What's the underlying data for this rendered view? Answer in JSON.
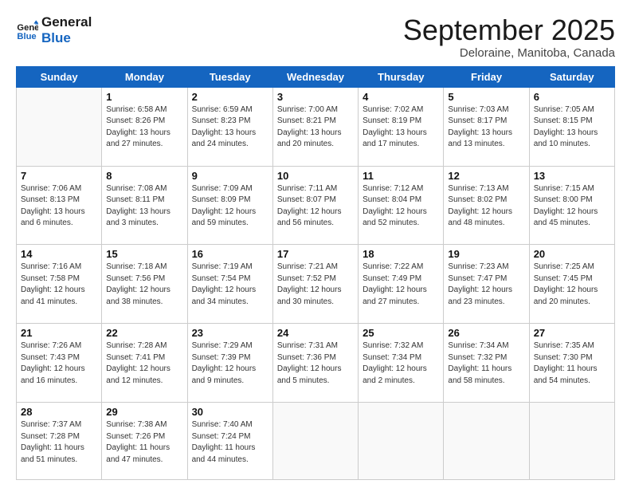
{
  "logo": {
    "line1": "General",
    "line2": "Blue"
  },
  "title": "September 2025",
  "subtitle": "Deloraine, Manitoba, Canada",
  "weekdays": [
    "Sunday",
    "Monday",
    "Tuesday",
    "Wednesday",
    "Thursday",
    "Friday",
    "Saturday"
  ],
  "weeks": [
    [
      {
        "day": "",
        "info": ""
      },
      {
        "day": "1",
        "info": "Sunrise: 6:58 AM\nSunset: 8:26 PM\nDaylight: 13 hours\nand 27 minutes."
      },
      {
        "day": "2",
        "info": "Sunrise: 6:59 AM\nSunset: 8:23 PM\nDaylight: 13 hours\nand 24 minutes."
      },
      {
        "day": "3",
        "info": "Sunrise: 7:00 AM\nSunset: 8:21 PM\nDaylight: 13 hours\nand 20 minutes."
      },
      {
        "day": "4",
        "info": "Sunrise: 7:02 AM\nSunset: 8:19 PM\nDaylight: 13 hours\nand 17 minutes."
      },
      {
        "day": "5",
        "info": "Sunrise: 7:03 AM\nSunset: 8:17 PM\nDaylight: 13 hours\nand 13 minutes."
      },
      {
        "day": "6",
        "info": "Sunrise: 7:05 AM\nSunset: 8:15 PM\nDaylight: 13 hours\nand 10 minutes."
      }
    ],
    [
      {
        "day": "7",
        "info": "Sunrise: 7:06 AM\nSunset: 8:13 PM\nDaylight: 13 hours\nand 6 minutes."
      },
      {
        "day": "8",
        "info": "Sunrise: 7:08 AM\nSunset: 8:11 PM\nDaylight: 13 hours\nand 3 minutes."
      },
      {
        "day": "9",
        "info": "Sunrise: 7:09 AM\nSunset: 8:09 PM\nDaylight: 12 hours\nand 59 minutes."
      },
      {
        "day": "10",
        "info": "Sunrise: 7:11 AM\nSunset: 8:07 PM\nDaylight: 12 hours\nand 56 minutes."
      },
      {
        "day": "11",
        "info": "Sunrise: 7:12 AM\nSunset: 8:04 PM\nDaylight: 12 hours\nand 52 minutes."
      },
      {
        "day": "12",
        "info": "Sunrise: 7:13 AM\nSunset: 8:02 PM\nDaylight: 12 hours\nand 48 minutes."
      },
      {
        "day": "13",
        "info": "Sunrise: 7:15 AM\nSunset: 8:00 PM\nDaylight: 12 hours\nand 45 minutes."
      }
    ],
    [
      {
        "day": "14",
        "info": "Sunrise: 7:16 AM\nSunset: 7:58 PM\nDaylight: 12 hours\nand 41 minutes."
      },
      {
        "day": "15",
        "info": "Sunrise: 7:18 AM\nSunset: 7:56 PM\nDaylight: 12 hours\nand 38 minutes."
      },
      {
        "day": "16",
        "info": "Sunrise: 7:19 AM\nSunset: 7:54 PM\nDaylight: 12 hours\nand 34 minutes."
      },
      {
        "day": "17",
        "info": "Sunrise: 7:21 AM\nSunset: 7:52 PM\nDaylight: 12 hours\nand 30 minutes."
      },
      {
        "day": "18",
        "info": "Sunrise: 7:22 AM\nSunset: 7:49 PM\nDaylight: 12 hours\nand 27 minutes."
      },
      {
        "day": "19",
        "info": "Sunrise: 7:23 AM\nSunset: 7:47 PM\nDaylight: 12 hours\nand 23 minutes."
      },
      {
        "day": "20",
        "info": "Sunrise: 7:25 AM\nSunset: 7:45 PM\nDaylight: 12 hours\nand 20 minutes."
      }
    ],
    [
      {
        "day": "21",
        "info": "Sunrise: 7:26 AM\nSunset: 7:43 PM\nDaylight: 12 hours\nand 16 minutes."
      },
      {
        "day": "22",
        "info": "Sunrise: 7:28 AM\nSunset: 7:41 PM\nDaylight: 12 hours\nand 12 minutes."
      },
      {
        "day": "23",
        "info": "Sunrise: 7:29 AM\nSunset: 7:39 PM\nDaylight: 12 hours\nand 9 minutes."
      },
      {
        "day": "24",
        "info": "Sunrise: 7:31 AM\nSunset: 7:36 PM\nDaylight: 12 hours\nand 5 minutes."
      },
      {
        "day": "25",
        "info": "Sunrise: 7:32 AM\nSunset: 7:34 PM\nDaylight: 12 hours\nand 2 minutes."
      },
      {
        "day": "26",
        "info": "Sunrise: 7:34 AM\nSunset: 7:32 PM\nDaylight: 11 hours\nand 58 minutes."
      },
      {
        "day": "27",
        "info": "Sunrise: 7:35 AM\nSunset: 7:30 PM\nDaylight: 11 hours\nand 54 minutes."
      }
    ],
    [
      {
        "day": "28",
        "info": "Sunrise: 7:37 AM\nSunset: 7:28 PM\nDaylight: 11 hours\nand 51 minutes."
      },
      {
        "day": "29",
        "info": "Sunrise: 7:38 AM\nSunset: 7:26 PM\nDaylight: 11 hours\nand 47 minutes."
      },
      {
        "day": "30",
        "info": "Sunrise: 7:40 AM\nSunset: 7:24 PM\nDaylight: 11 hours\nand 44 minutes."
      },
      {
        "day": "",
        "info": ""
      },
      {
        "day": "",
        "info": ""
      },
      {
        "day": "",
        "info": ""
      },
      {
        "day": "",
        "info": ""
      }
    ]
  ]
}
